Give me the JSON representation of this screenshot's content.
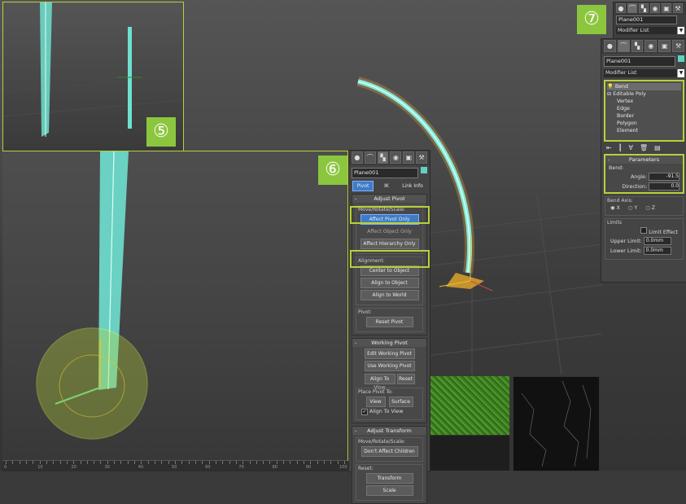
{
  "badges": {
    "five": "⑤",
    "six": "⑥",
    "seven": "⑦"
  },
  "pivot_panel": {
    "object_name": "Plane001",
    "tabs": [
      "Pivot",
      "IK",
      "Link Info"
    ],
    "adjust_pivot": {
      "title": "Adjust Pivot",
      "move_group_label": "Move/Rotate/Scale:",
      "buttons": [
        "Affect Pivot Only",
        "Affect Object Only",
        "Affect Hierarchy Only"
      ],
      "alignment_label": "Alignment:",
      "alignment_buttons": [
        "Center to Object",
        "Align to Object",
        "Align to World"
      ],
      "pivot_label": "Pivot:",
      "reset_pivot": "Reset Pivot"
    },
    "working_pivot": {
      "title": "Working Pivot",
      "edit": "Edit Working Pivot",
      "use": "Use Working Pivot",
      "align_to_view": "Align To View",
      "reset": "Reset",
      "place_label": "Place Pivot To:",
      "view": "View",
      "surface": "Surface",
      "align_to_view_check": "Align To View"
    },
    "adjust_transform": {
      "title": "Adjust Transform",
      "move_label": "Move/Rotate/Scale:",
      "dont_affect": "Don't Affect Children",
      "reset_label": "Reset:",
      "transform": "Transform",
      "scale": "Scale"
    }
  },
  "modify_panel_small": {
    "object_name": "Plane001",
    "modifier_list": "Modifier List"
  },
  "modify_panel": {
    "object_name": "Plane001",
    "modifier_list": "Modifier List",
    "stack": [
      "Bend",
      "Editable Poly",
      "Vertex",
      "Edge",
      "Border",
      "Polygon",
      "Element"
    ],
    "parameters_title": "Parameters",
    "bend_label": "Bend:",
    "angle_label": "Angle:",
    "angle_value": "-91.5",
    "direction_label": "Direction:",
    "direction_value": "0.0",
    "bend_axis_label": "Bend Axis:",
    "axes": [
      "X",
      "Y",
      "Z"
    ],
    "limits_label": "Limits",
    "limit_effect": "Limit Effect",
    "upper_limit_label": "Upper Limit:",
    "upper_limit_value": "0.0mm",
    "lower_limit_label": "Lower Limit:",
    "lower_limit_value": "0.0mm"
  },
  "ruler": {
    "labels": [
      "0",
      "10",
      "20",
      "30",
      "40",
      "50",
      "60",
      "70",
      "80",
      "90",
      "100"
    ]
  },
  "colors": {
    "highlight": "#b6d13a",
    "badge": "#8cc63f",
    "object": "#5fd3c0"
  }
}
